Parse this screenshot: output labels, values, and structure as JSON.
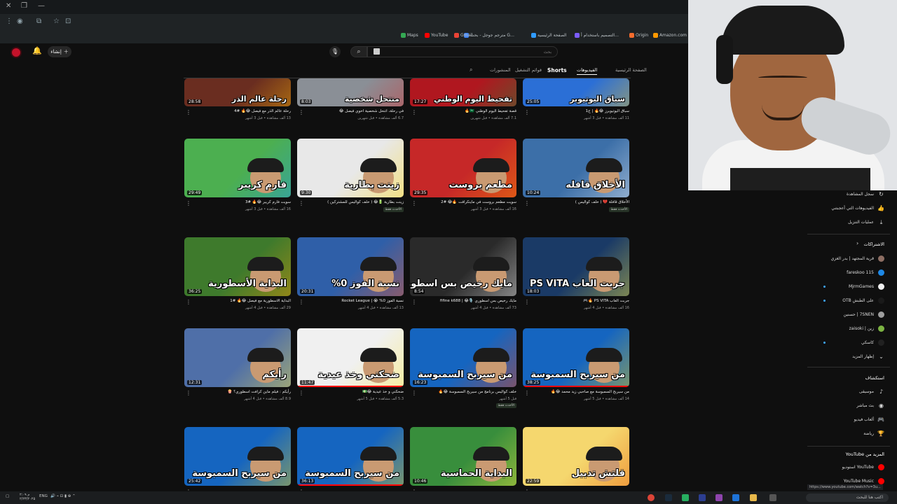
{
  "browser": {
    "bookmarks": [
      {
        "label": "Amazon.com Sh…",
        "color": "#ff9900"
      },
      {
        "label": "Origin",
        "color": "#f56c2d"
      },
      {
        "label": "التصميم باستخدام أ…",
        "color": "#7b5cff"
      },
      {
        "label": "الصفحة الرئيسية",
        "color": "#2f9bff"
      },
      {
        "label": "مترجم جوجل - بحث G…",
        "color": "#4285f4"
      },
      {
        "label": "Gmail",
        "color": "#ea4335"
      },
      {
        "label": "YouTube",
        "color": "#ff0000"
      },
      {
        "label": "Maps",
        "color": "#34a853"
      }
    ]
  },
  "header": {
    "create_label": "إنشاء",
    "search_placeholder": "بحث"
  },
  "channel_tabs": [
    {
      "label": "الصفحة الرئيسية",
      "active": false
    },
    {
      "label": "الفيديوهات",
      "active": true
    },
    {
      "label": "Shorts",
      "active": false
    },
    {
      "label": "قوائم التشغيل",
      "active": false
    },
    {
      "label": "المنشورات",
      "active": false
    }
  ],
  "videos": [
    {
      "thumb_text": "سباق اليوتيوبر",
      "duration": "25:05",
      "title": "سباق اليوتيوبرز 😂🔥 | ج1",
      "stats": "11 ألف مشاهدة • قبل 3 أشهر",
      "bg": "#2b6fd6",
      "accent": "#f5c518",
      "progress": 0
    },
    {
      "thumb_text": "تفحيط اليوم الوطني",
      "duration": "17:27",
      "title": "قصة تفحيط اليوم الوطني 🇸🇦🔥",
      "stats": "7.1 ألف مشاهدة • قبل شهرين",
      "bg": "#b0171f",
      "accent": "#1b8a3a",
      "progress": 0
    },
    {
      "thumb_text": "منتحل شخصية",
      "duration": "8:03",
      "title": "في رحلة، اتنحل شخصية اخوي فيصل 😂",
      "stats": "6.7 ألف مشاهدة • قبل شهرين",
      "bg": "#8a8f96",
      "accent": "#d32f2f",
      "progress": 0
    },
    {
      "thumb_text": "رحلة عالم الذر",
      "duration": "28:58",
      "title": "رحلة عالم الذر مع فيصل 😂🔥 #4",
      "stats": "13 ألف مشاهدة • قبل 3 أشهر",
      "bg": "#6a2d20",
      "accent": "#f6b400",
      "progress": 0
    },
    {
      "thumb_text": "الأخلاق قافله",
      "duration": "10:24",
      "title": "الأخلاق قافلة 💔 ( خلف كواليس )",
      "stats": "",
      "bg": "#3c6fa8",
      "accent": "#ffffff",
      "progress": 0,
      "badge": "الأحدث فقط"
    },
    {
      "thumb_text": "مطعم بروست",
      "duration": "29:35",
      "title": "سويت مطعم بروست في ماينكرافت 🔥😂 #2",
      "stats": "16 ألف مشاهدة • قبل 3 أشهر",
      "bg": "#c62828",
      "accent": "#ff9800",
      "progress": 0
    },
    {
      "thumb_text": "زينت بطارية",
      "duration": "9:30",
      "title": "زينت بطارية 🔋😂 ( خلف كواليس للمشتركين )",
      "stats": "",
      "bg": "#e8e8e8",
      "accent": "#ffd600",
      "progress": 0,
      "badge": "الأحدث فقط"
    },
    {
      "thumb_text": "فارم كريبر",
      "duration": "29:49",
      "title": "سويت فارم كريبر 😂🔥 #3",
      "stats": "16 ألف مشاهدة • قبل 3 أشهر",
      "bg": "#4caf50",
      "accent": "#2196f3",
      "progress": 0
    },
    {
      "thumb_text": "جربت العاب PS VITA",
      "duration": "18:03",
      "title": "جربت العاب PS VITA 🔥🎮",
      "stats": "16 ألف مشاهدة • قبل 4 أشهر",
      "bg": "#1a3a66",
      "accent": "#ffeb3b",
      "progress": 0
    },
    {
      "thumb_text": "مايك رخيص بس اسطوري",
      "duration": "8:54",
      "title": "مايك رخيص بس اسطوري 🎙️😂 | fifine k688",
      "stats": "73 ألف مشاهدة • قبل 4 أشهر",
      "bg": "#2a2a2a",
      "accent": "#ffffff",
      "progress": 0
    },
    {
      "thumb_text": "نسبة الفوز 0%",
      "duration": "20:31",
      "title": "نسبة الفوز 0% 😭 | Rocket League",
      "stats": "13 ألف مشاهدة • قبل 4 أشهر",
      "bg": "#2f5fa8",
      "accent": "#ff5722",
      "progress": 0
    },
    {
      "thumb_text": "البداية الأسطورية",
      "duration": "36:25",
      "title": "البداية الاسطورية مع فيصل 😂🔥 #1",
      "stats": "29 ألف مشاهدة • قبل 4 أشهر",
      "bg": "#3e7a2c",
      "accent": "#ff9800",
      "progress": 0
    },
    {
      "thumb_text": "من سيربح السمبوسة",
      "duration": "38:25",
      "title": "من سيربح السمبوسة مع صاحبي زيد محمد 😂🔥",
      "stats": "14 ألف مشاهدة • قبل 5 أشهر",
      "bg": "#1565c0",
      "accent": "#ffd600",
      "progress": 1
    },
    {
      "thumb_text": "من سيربح السمبوسة",
      "duration": "16:23",
      "title": "خلف كواليس برنامج من سيربح السمبوسة 😂🔥",
      "stats": "قبل 5 أشهر",
      "bg": "#1565c0",
      "accent": "#ff3d00",
      "progress": 0,
      "badge": "الأحدث فقط"
    },
    {
      "thumb_text": "ضحكني وخذ عيدية",
      "duration": "11:47",
      "title": "ضحكني و خذ عيدية 😂💵",
      "stats": "5.3 ألف مشاهدة • قبل 5 أشهر",
      "bg": "#f0f0f0",
      "accent": "#ffeb3b",
      "progress": 1
    },
    {
      "thumb_text": "رأيكم",
      "duration": "12:31",
      "title": "رأيكم : فيلم ماين كرافت اسطوري؟ 🍿",
      "stats": "8.9 ألف مشاهدة • قبل 4 أشهر",
      "bg": "#4f6fa8",
      "accent": "#ffeb3b",
      "progress": 0
    },
    {
      "thumb_text": "قلتش تدبيل",
      "duration": "22:59",
      "title": "",
      "stats": "",
      "bg": "#f5d76e",
      "accent": "#e65100",
      "progress": 0
    },
    {
      "thumb_text": "البداية الحماسية",
      "duration": "10:46",
      "title": "",
      "stats": "",
      "bg": "#388e3c",
      "accent": "#ffeb3b",
      "progress": 0
    },
    {
      "thumb_text": "من سيربح السمبوسة",
      "duration": "36:13",
      "title": "",
      "stats": "",
      "bg": "#1565c0",
      "accent": "#ffd600",
      "progress": 1
    },
    {
      "thumb_text": "من سيربح السمبوسة",
      "duration": "25:42",
      "title": "",
      "stats": "",
      "bg": "#1565c0",
      "accent": "#ffd600",
      "progress": 0
    }
  ],
  "sidebar": {
    "you_items": [
      {
        "label": "سجل المشاهدة",
        "icon": "↻"
      },
      {
        "label": "الفيديوهات التي أعجبتني",
        "icon": "👍"
      },
      {
        "label": "عمليات التنزيل",
        "icon": "⤓"
      }
    ],
    "subscriptions_title": "الاشتراكات",
    "subscriptions": [
      {
        "label": "قرية المجتهد | بدر الغزي",
        "color": "#8d6e63",
        "dot": false
      },
      {
        "label": "fareskoo 115",
        "color": "#1e88e5",
        "dot": false
      },
      {
        "label": "MjrmGames",
        "color": "#eeeeee",
        "dot": true
      },
      {
        "label": "على الطبش OTB",
        "color": "#1a1a1a",
        "dot": true
      },
      {
        "label": "7SNEN | حسنين",
        "color": "#9e9e9e",
        "dot": false
      },
      {
        "label": "زين | zaisoki",
        "color": "#7cb342",
        "dot": false
      },
      {
        "label": "كاسكي",
        "color": "#212121",
        "dot": true
      },
      {
        "label": "إظهار المزيد",
        "color": "",
        "dot": false
      }
    ],
    "explore_title": "استكشاف",
    "explore": [
      {
        "label": "موسيقى",
        "icon": "♪"
      },
      {
        "label": "بث مباشر",
        "icon": "◉"
      },
      {
        "label": "ألعاب فيديو",
        "icon": "🎮"
      },
      {
        "label": "رياضة",
        "icon": "🏆"
      }
    ],
    "more_title": "المزيد من YouTube",
    "more": [
      {
        "label": "YouTube استوديو",
        "color": "#ff0000"
      },
      {
        "label": "YouTube Music",
        "color": "#ff0000"
      }
    ]
  },
  "status_url": "https://www.youtube.com/watch?v=3u...",
  "taskbar": {
    "search_placeholder": "اكتب هنا للبحث",
    "lang": "ENG",
    "time": "۲:۰۹ م",
    "date": "۲/۲۳/۲۰۲۵"
  }
}
